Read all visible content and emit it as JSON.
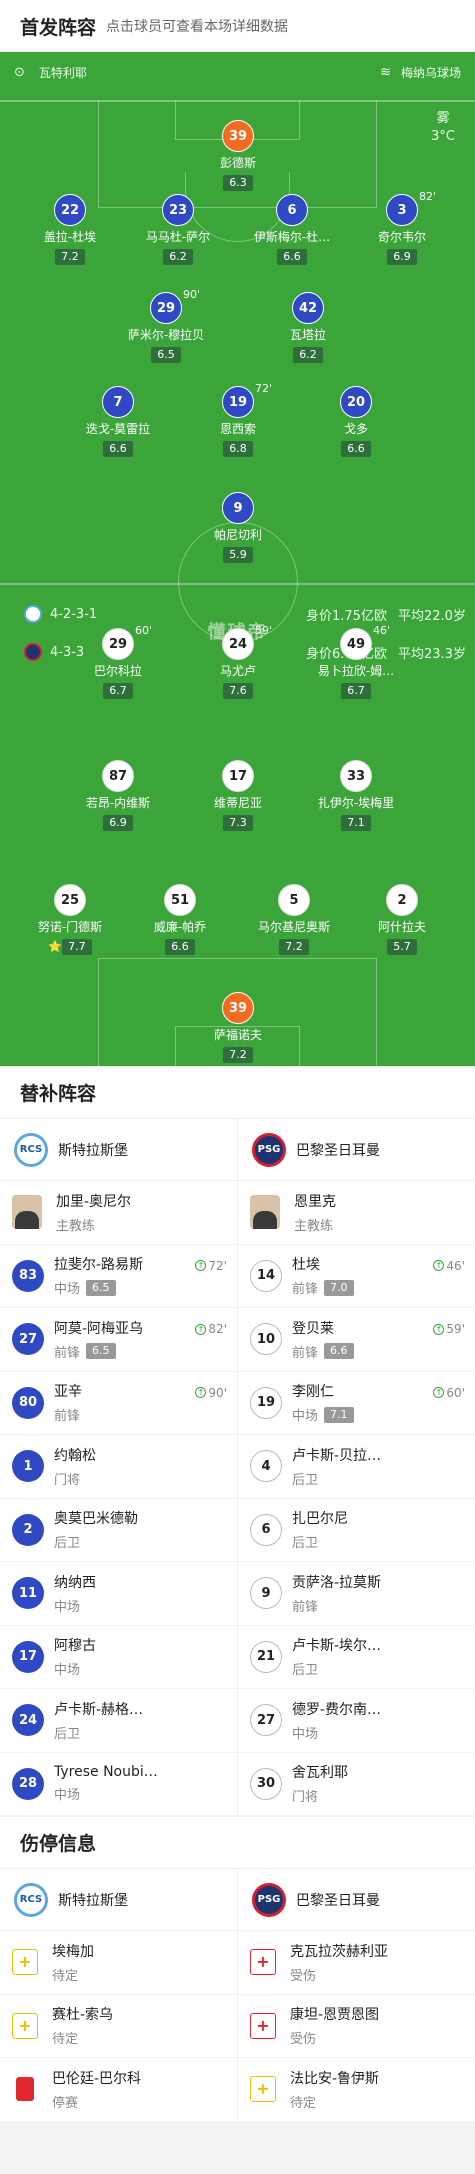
{
  "header": {
    "title": "首发阵容",
    "subtitle": "点击球员可查看本场详细数据"
  },
  "pitch": {
    "home_team": "斯特拉斯堡",
    "home_label": "瓦特利耶",
    "stadium": "梅纳乌球场",
    "weather": {
      "condition": "雾",
      "temp": "3°C"
    },
    "home_formation": {
      "formation": "4-2-3-1",
      "value": "身价1.75亿欧",
      "age": "平均22.0岁"
    },
    "away_formation": {
      "formation": "4-3-3",
      "value": "身价6.75亿欧",
      "age": "平均23.3岁"
    },
    "watermark": "懂球帝",
    "home_players": [
      {
        "num": "39",
        "name": "彭德斯",
        "rating": "6.3",
        "gk": true
      },
      {
        "num": "22",
        "name": "盖拉-杜埃",
        "rating": "7.2",
        "ball": true
      },
      {
        "num": "23",
        "name": "马马杜-萨尔",
        "rating": "6.2",
        "captain": true
      },
      {
        "num": "6",
        "name": "伊斯梅尔-杜…",
        "rating": "6.6"
      },
      {
        "num": "3",
        "name": "奇尔韦尔",
        "rating": "6.9",
        "sub": "82'",
        "ball": true
      },
      {
        "num": "29",
        "name": "萨米尔-穆拉贝",
        "rating": "6.5",
        "sub": "90'"
      },
      {
        "num": "42",
        "name": "瓦塔拉",
        "rating": "6.2"
      },
      {
        "num": "7",
        "name": "迭戈-莫雷拉",
        "rating": "6.6",
        "ycard": true
      },
      {
        "num": "19",
        "name": "恩西索",
        "rating": "6.8",
        "sub": "72'"
      },
      {
        "num": "20",
        "name": "戈多",
        "rating": "6.6"
      },
      {
        "num": "9",
        "name": "帕尼切利",
        "rating": "5.9"
      }
    ],
    "away_players": [
      {
        "num": "29",
        "name": "巴尔科拉",
        "rating": "6.7",
        "sub": "60'",
        "ball": true
      },
      {
        "num": "24",
        "name": "马尤卢",
        "rating": "7.6",
        "sub": "59'",
        "ball": true
      },
      {
        "num": "49",
        "name": "易卜拉欣-姆…",
        "rating": "6.7",
        "sub": "46'"
      },
      {
        "num": "87",
        "name": "若昂-内维斯",
        "rating": "6.9"
      },
      {
        "num": "17",
        "name": "维蒂尼亚",
        "rating": "7.3"
      },
      {
        "num": "33",
        "name": "扎伊尔-埃梅里",
        "rating": "7.1",
        "ball": true
      },
      {
        "num": "25",
        "name": "努诺-门德斯",
        "rating": "7.7",
        "star": true,
        "ball": true
      },
      {
        "num": "51",
        "name": "威廉-帕乔",
        "rating": "6.6"
      },
      {
        "num": "5",
        "name": "马尔基尼奥斯",
        "rating": "7.2",
        "captain": true
      },
      {
        "num": "2",
        "name": "阿什拉夫",
        "rating": "5.7",
        "rcard": true
      },
      {
        "num": "39",
        "name": "萨福诺夫",
        "rating": "7.2",
        "gk": true
      }
    ]
  },
  "subs": {
    "title": "替补阵容",
    "home": {
      "team": "斯特拉斯堡",
      "coach": {
        "name": "加里-奥尼尔",
        "role": "主教练"
      },
      "players": [
        {
          "num": "83",
          "name": "拉斐尔-路易斯",
          "pos": "中场",
          "rating": "6.5",
          "in": "72'"
        },
        {
          "num": "27",
          "name": "阿莫-阿梅亚乌",
          "pos": "前锋",
          "rating": "6.5",
          "in": "82'"
        },
        {
          "num": "80",
          "name": "亚辛",
          "pos": "前锋",
          "in": "90'"
        },
        {
          "num": "1",
          "name": "约翰松",
          "pos": "门将"
        },
        {
          "num": "2",
          "name": "奥莫巴米德勒",
          "pos": "后卫"
        },
        {
          "num": "11",
          "name": "纳纳西",
          "pos": "中场"
        },
        {
          "num": "17",
          "name": "阿穆古",
          "pos": "中场"
        },
        {
          "num": "24",
          "name": "卢卡斯-赫格…",
          "pos": "后卫"
        },
        {
          "num": "28",
          "name": "Tyrese Noubi…",
          "pos": "中场"
        }
      ]
    },
    "away": {
      "team": "巴黎圣日耳曼",
      "coach": {
        "name": "恩里克",
        "role": "主教练"
      },
      "players": [
        {
          "num": "14",
          "name": "杜埃",
          "pos": "前锋",
          "rating": "7.0",
          "in": "46'"
        },
        {
          "num": "10",
          "name": "登贝莱",
          "pos": "前锋",
          "rating": "6.6",
          "in": "59'"
        },
        {
          "num": "19",
          "name": "李刚仁",
          "pos": "中场",
          "rating": "7.1",
          "in": "60'"
        },
        {
          "num": "4",
          "name": "卢卡斯-贝拉…",
          "pos": "后卫"
        },
        {
          "num": "6",
          "name": "扎巴尔尼",
          "pos": "后卫"
        },
        {
          "num": "9",
          "name": "贡萨洛-拉莫斯",
          "pos": "前锋"
        },
        {
          "num": "21",
          "name": "卢卡斯-埃尔…",
          "pos": "后卫"
        },
        {
          "num": "27",
          "name": "德罗-费尔南…",
          "pos": "中场"
        },
        {
          "num": "30",
          "name": "舍瓦利耶",
          "pos": "门将"
        }
      ]
    }
  },
  "injuries": {
    "title": "伤停信息",
    "home": {
      "team": "斯特拉斯堡",
      "players": [
        {
          "name": "埃梅加",
          "status": "待定",
          "type": "wait"
        },
        {
          "name": "赛杜-索乌",
          "status": "待定",
          "type": "wait"
        },
        {
          "name": "巴伦廷-巴尔科",
          "status": "停赛",
          "type": "susp"
        }
      ]
    },
    "away": {
      "team": "巴黎圣日耳曼",
      "players": [
        {
          "name": "克瓦拉茨赫利亚",
          "status": "受伤",
          "type": "hurt"
        },
        {
          "name": "康坦-恩贾恩图",
          "status": "受伤",
          "type": "hurt"
        },
        {
          "name": "法比安-鲁伊斯",
          "status": "待定",
          "type": "wait"
        }
      ]
    }
  },
  "colors": {
    "pitch": "#3ba53a",
    "home": "#2f49c4",
    "goalkeeper": "#f26b20",
    "rating_bg": "#2d6e3a"
  }
}
